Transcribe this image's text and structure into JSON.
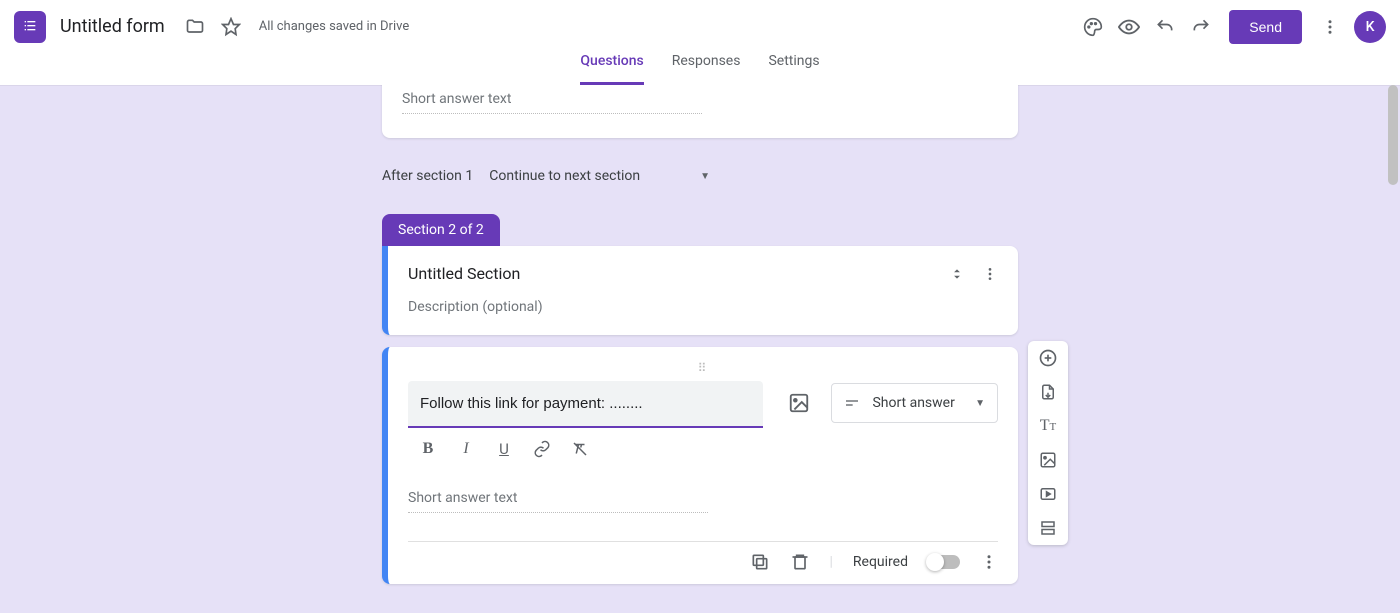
{
  "header": {
    "form_title": "Untitled form",
    "save_status": "All changes saved in Drive",
    "send_label": "Send",
    "avatar_letter": "K"
  },
  "tabs": {
    "questions": "Questions",
    "responses": "Responses",
    "settings": "Settings"
  },
  "prev_question": {
    "short_answer_placeholder": "Short answer text"
  },
  "after_section": {
    "label": "After section 1",
    "action": "Continue to next section"
  },
  "section_pill": "Section 2 of 2",
  "section_header": {
    "title": "Untitled Section",
    "description_placeholder": "Description (optional)"
  },
  "question": {
    "text": "Follow this link for payment: ........",
    "type_label": "Short answer",
    "short_answer_placeholder": "Short answer text"
  },
  "footer": {
    "required_label": "Required"
  }
}
